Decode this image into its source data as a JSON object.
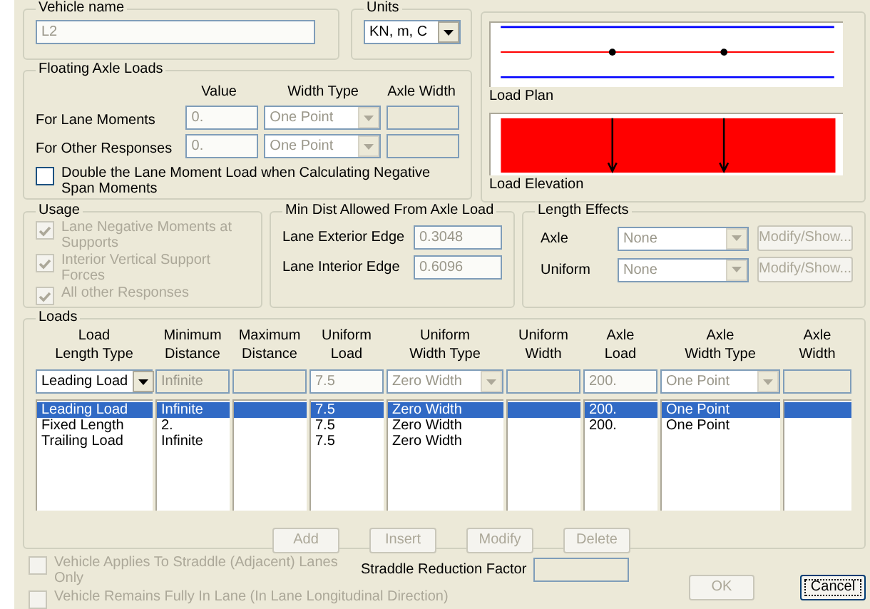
{
  "vehicle_name": {
    "label": "Vehicle name",
    "value": "L2",
    "disabled": true
  },
  "units": {
    "label": "Units",
    "value": "KN, m, C"
  },
  "floating_axle_loads": {
    "title": "Floating Axle Loads",
    "columns": [
      "Value",
      "Width Type",
      "Axle Width"
    ],
    "rows": [
      {
        "label": "For Lane Moments",
        "value": "0.",
        "width_type": "One Point",
        "disabled": true
      },
      {
        "label": "For Other Responses",
        "value": "0.",
        "width_type": "One Point",
        "disabled": true
      }
    ],
    "double_checkbox": {
      "label": "Double the Lane Moment Load when Calculating Negative Span Moments",
      "checked": false,
      "disabled": false
    }
  },
  "preview": {
    "plan_label": "Load Plan",
    "elevation_label": "Load Elevation"
  },
  "usage": {
    "title": "Usage",
    "items": [
      {
        "label": "Lane Negative Moments at Supports",
        "checked": true,
        "disabled": true
      },
      {
        "label": "Interior Vertical Support Forces",
        "checked": true,
        "disabled": true
      },
      {
        "label": "All other Responses",
        "checked": true,
        "disabled": true
      }
    ]
  },
  "min_dist": {
    "title": "Min Dist Allowed From Axle Load",
    "fields": [
      {
        "label": "Lane Exterior Edge",
        "value": "0.3048",
        "disabled": true
      },
      {
        "label": "Lane Interior Edge",
        "value": "0.6096",
        "disabled": true
      }
    ]
  },
  "length_effects": {
    "title": "Length Effects",
    "rows": [
      {
        "label": "Axle",
        "value": "None",
        "button": "Modify/Show...",
        "disabled": true
      },
      {
        "label": "Uniform",
        "value": "None",
        "button": "Modify/Show...",
        "disabled": true
      }
    ]
  },
  "loads": {
    "title": "Loads",
    "columns": [
      {
        "lines": [
          "Load",
          "Length Type"
        ]
      },
      {
        "lines": [
          "Minimum",
          "Distance"
        ]
      },
      {
        "lines": [
          "Maximum",
          "Distance"
        ]
      },
      {
        "lines": [
          "Uniform",
          "Load"
        ]
      },
      {
        "lines": [
          "Uniform",
          "Width Type"
        ]
      },
      {
        "lines": [
          "Uniform",
          "Width"
        ]
      },
      {
        "lines": [
          "Axle",
          "Load"
        ]
      },
      {
        "lines": [
          "Axle",
          "Width Type"
        ]
      },
      {
        "lines": [
          "Axle",
          "Width"
        ]
      }
    ],
    "edit_row": [
      {
        "kind": "dropdown",
        "value": "Leading Load",
        "disabled": false
      },
      {
        "kind": "field",
        "value": "Infinite",
        "disabled": true
      },
      {
        "kind": "field",
        "disabled": true
      },
      {
        "kind": "field",
        "value": "7.5",
        "disabled": true
      },
      {
        "kind": "dropdown",
        "value": "Zero Width",
        "disabled": true
      },
      {
        "kind": "field",
        "disabled": true
      },
      {
        "kind": "field",
        "value": "200.",
        "disabled": true
      },
      {
        "kind": "dropdown",
        "value": "One Point",
        "disabled": true
      },
      {
        "kind": "field",
        "disabled": true
      }
    ],
    "rows": [
      {
        "selected": true,
        "cells": [
          "Leading Load",
          "Infinite",
          null,
          "7.5",
          "Zero Width",
          null,
          "200.",
          "One Point",
          null
        ]
      },
      {
        "selected": false,
        "cells": [
          "Fixed Length",
          "2.",
          null,
          "7.5",
          "Zero Width",
          null,
          "200.",
          "One Point",
          null
        ]
      },
      {
        "selected": false,
        "cells": [
          "Trailing Load",
          "Infinite",
          null,
          "7.5",
          "Zero Width",
          null,
          null,
          null,
          null
        ]
      }
    ],
    "buttons": [
      {
        "label": "Add",
        "disabled": true
      },
      {
        "label": "Insert",
        "disabled": true
      },
      {
        "label": "Modify",
        "disabled": true
      },
      {
        "label": "Delete",
        "disabled": true
      }
    ]
  },
  "straddle_checkbox": {
    "label": "Vehicle Applies To Straddle (Adjacent) Lanes Only",
    "checked": false,
    "disabled": true
  },
  "fully_in_lane_checkbox": {
    "label": "Vehicle Remains Fully In Lane (In Lane Longitudinal Direction)",
    "checked": false,
    "disabled": true
  },
  "straddle_factor": {
    "label": "Straddle Reduction Factor",
    "disabled": true
  },
  "buttons": [
    {
      "label": "OK",
      "disabled": true,
      "focused": false
    },
    {
      "label": "Cancel",
      "disabled": false,
      "focused": true
    }
  ]
}
